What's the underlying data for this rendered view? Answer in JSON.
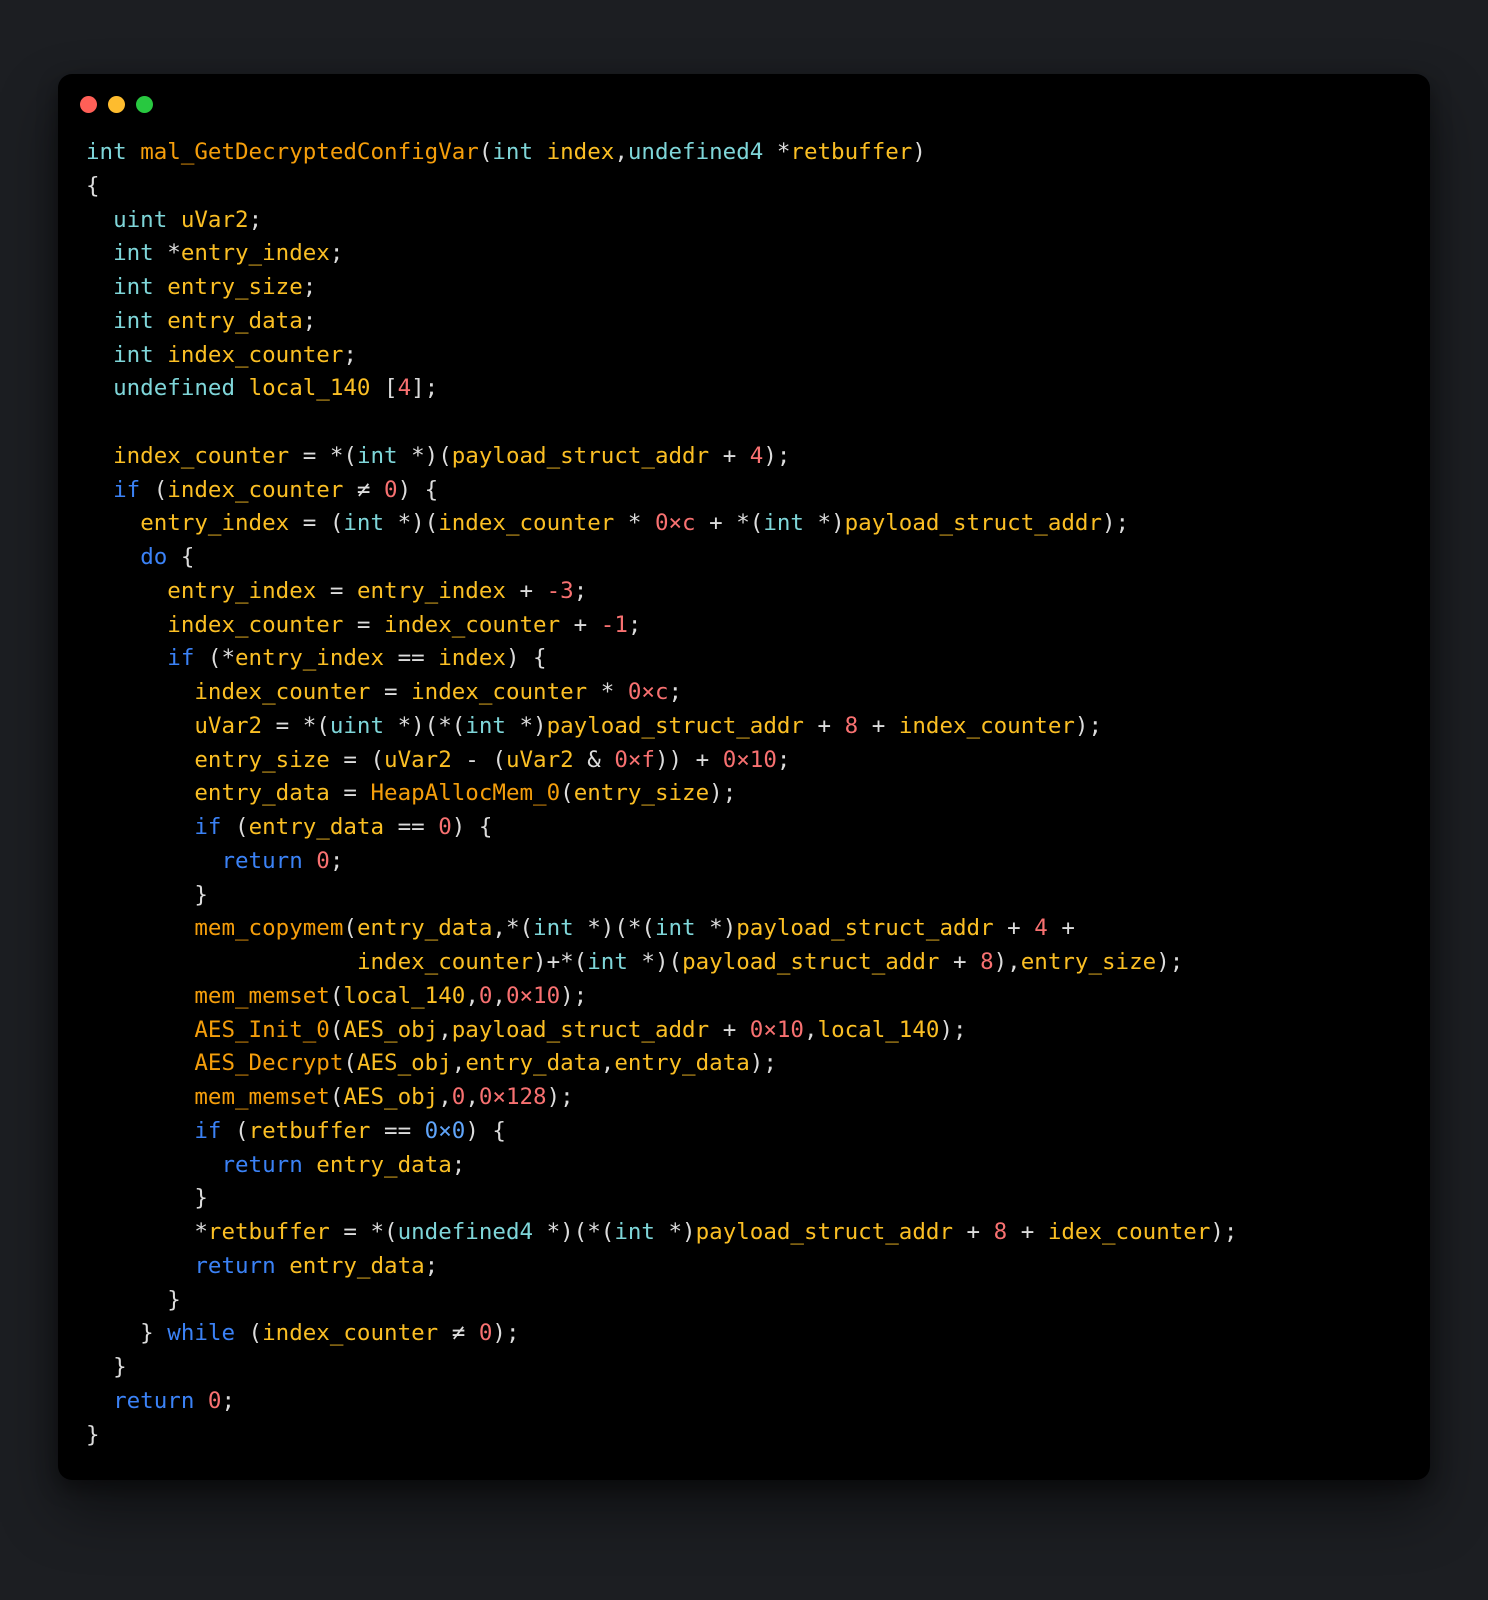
{
  "window": {
    "traffic_icons": [
      "close-icon",
      "minimize-icon",
      "zoom-icon"
    ]
  },
  "colors": {
    "bg_outer": "#1c1e22",
    "bg_code": "#000000",
    "plain": "#dcdcdc",
    "type": "#7fd6d9",
    "keyword": "#3b82f6",
    "function": "#f59e0b",
    "identifier": "#fbbf24",
    "number": "#f87171",
    "constant": "#60a5fa"
  },
  "code": {
    "tokens": [
      [
        [
          "ty",
          "int"
        ],
        [
          "pl",
          " "
        ],
        [
          "fn",
          "mal_GetDecryptedConfigVar"
        ],
        [
          "pl",
          "("
        ],
        [
          "ty",
          "int"
        ],
        [
          "pl",
          " "
        ],
        [
          "id",
          "index"
        ],
        [
          "pl",
          ","
        ],
        [
          "ty",
          "undefined4"
        ],
        [
          "pl",
          " *"
        ],
        [
          "id",
          "retbuffer"
        ],
        [
          "pl",
          ")"
        ]
      ],
      [
        [
          "pl",
          "{"
        ]
      ],
      [
        [
          "pl",
          "  "
        ],
        [
          "ty",
          "uint"
        ],
        [
          "pl",
          " "
        ],
        [
          "id",
          "uVar2"
        ],
        [
          "pl",
          ";"
        ]
      ],
      [
        [
          "pl",
          "  "
        ],
        [
          "ty",
          "int"
        ],
        [
          "pl",
          " *"
        ],
        [
          "id",
          "entry_index"
        ],
        [
          "pl",
          ";"
        ]
      ],
      [
        [
          "pl",
          "  "
        ],
        [
          "ty",
          "int"
        ],
        [
          "pl",
          " "
        ],
        [
          "id",
          "entry_size"
        ],
        [
          "pl",
          ";"
        ]
      ],
      [
        [
          "pl",
          "  "
        ],
        [
          "ty",
          "int"
        ],
        [
          "pl",
          " "
        ],
        [
          "id",
          "entry_data"
        ],
        [
          "pl",
          ";"
        ]
      ],
      [
        [
          "pl",
          "  "
        ],
        [
          "ty",
          "int"
        ],
        [
          "pl",
          " "
        ],
        [
          "id",
          "index_counter"
        ],
        [
          "pl",
          ";"
        ]
      ],
      [
        [
          "pl",
          "  "
        ],
        [
          "ty",
          "undefined"
        ],
        [
          "pl",
          " "
        ],
        [
          "id",
          "local_140"
        ],
        [
          "pl",
          " ["
        ],
        [
          "num",
          "4"
        ],
        [
          "pl",
          "];"
        ]
      ],
      [],
      [
        [
          "pl",
          "  "
        ],
        [
          "id",
          "index_counter"
        ],
        [
          "pl",
          " = *("
        ],
        [
          "ty",
          "int"
        ],
        [
          "pl",
          " *)("
        ],
        [
          "id",
          "payload_struct_addr"
        ],
        [
          "pl",
          " + "
        ],
        [
          "num",
          "4"
        ],
        [
          "pl",
          ");"
        ]
      ],
      [
        [
          "pl",
          "  "
        ],
        [
          "kw",
          "if"
        ],
        [
          "pl",
          " ("
        ],
        [
          "id",
          "index_counter"
        ],
        [
          "pl",
          " ≠ "
        ],
        [
          "num",
          "0"
        ],
        [
          "pl",
          ") {"
        ]
      ],
      [
        [
          "pl",
          "    "
        ],
        [
          "id",
          "entry_index"
        ],
        [
          "pl",
          " = ("
        ],
        [
          "ty",
          "int"
        ],
        [
          "pl",
          " *)("
        ],
        [
          "id",
          "index_counter"
        ],
        [
          "pl",
          " * "
        ],
        [
          "num",
          "0×c"
        ],
        [
          "pl",
          " + *("
        ],
        [
          "ty",
          "int"
        ],
        [
          "pl",
          " *)"
        ],
        [
          "id",
          "payload_struct_addr"
        ],
        [
          "pl",
          ");"
        ]
      ],
      [
        [
          "pl",
          "    "
        ],
        [
          "kw",
          "do"
        ],
        [
          "pl",
          " {"
        ]
      ],
      [
        [
          "pl",
          "      "
        ],
        [
          "id",
          "entry_index"
        ],
        [
          "pl",
          " = "
        ],
        [
          "id",
          "entry_index"
        ],
        [
          "pl",
          " + "
        ],
        [
          "num",
          "-3"
        ],
        [
          "pl",
          ";"
        ]
      ],
      [
        [
          "pl",
          "      "
        ],
        [
          "id",
          "index_counter"
        ],
        [
          "pl",
          " = "
        ],
        [
          "id",
          "index_counter"
        ],
        [
          "pl",
          " + "
        ],
        [
          "num",
          "-1"
        ],
        [
          "pl",
          ";"
        ]
      ],
      [
        [
          "pl",
          "      "
        ],
        [
          "kw",
          "if"
        ],
        [
          "pl",
          " (*"
        ],
        [
          "id",
          "entry_index"
        ],
        [
          "pl",
          " == "
        ],
        [
          "id",
          "index"
        ],
        [
          "pl",
          ") {"
        ]
      ],
      [
        [
          "pl",
          "        "
        ],
        [
          "id",
          "index_counter"
        ],
        [
          "pl",
          " = "
        ],
        [
          "id",
          "index_counter"
        ],
        [
          "pl",
          " * "
        ],
        [
          "num",
          "0×c"
        ],
        [
          "pl",
          ";"
        ]
      ],
      [
        [
          "pl",
          "        "
        ],
        [
          "id",
          "uVar2"
        ],
        [
          "pl",
          " = *("
        ],
        [
          "ty",
          "uint"
        ],
        [
          "pl",
          " *)(*("
        ],
        [
          "ty",
          "int"
        ],
        [
          "pl",
          " *)"
        ],
        [
          "id",
          "payload_struct_addr"
        ],
        [
          "pl",
          " + "
        ],
        [
          "num",
          "8"
        ],
        [
          "pl",
          " + "
        ],
        [
          "id",
          "index_counter"
        ],
        [
          "pl",
          ");"
        ]
      ],
      [
        [
          "pl",
          "        "
        ],
        [
          "id",
          "entry_size"
        ],
        [
          "pl",
          " = ("
        ],
        [
          "id",
          "uVar2"
        ],
        [
          "pl",
          " - ("
        ],
        [
          "id",
          "uVar2"
        ],
        [
          "pl",
          " & "
        ],
        [
          "num",
          "0×f"
        ],
        [
          "pl",
          ")) + "
        ],
        [
          "num",
          "0×10"
        ],
        [
          "pl",
          ";"
        ]
      ],
      [
        [
          "pl",
          "        "
        ],
        [
          "id",
          "entry_data"
        ],
        [
          "pl",
          " = "
        ],
        [
          "fn",
          "HeapAllocMem_0"
        ],
        [
          "pl",
          "("
        ],
        [
          "id",
          "entry_size"
        ],
        [
          "pl",
          ");"
        ]
      ],
      [
        [
          "pl",
          "        "
        ],
        [
          "kw",
          "if"
        ],
        [
          "pl",
          " ("
        ],
        [
          "id",
          "entry_data"
        ],
        [
          "pl",
          " == "
        ],
        [
          "num",
          "0"
        ],
        [
          "pl",
          ") {"
        ]
      ],
      [
        [
          "pl",
          "          "
        ],
        [
          "kw",
          "return"
        ],
        [
          "pl",
          " "
        ],
        [
          "num",
          "0"
        ],
        [
          "pl",
          ";"
        ]
      ],
      [
        [
          "pl",
          "        }"
        ]
      ],
      [
        [
          "pl",
          "        "
        ],
        [
          "fn",
          "mem_copymem"
        ],
        [
          "pl",
          "("
        ],
        [
          "id",
          "entry_data"
        ],
        [
          "pl",
          ",*("
        ],
        [
          "ty",
          "int"
        ],
        [
          "pl",
          " *)(*("
        ],
        [
          "ty",
          "int"
        ],
        [
          "pl",
          " *)"
        ],
        [
          "id",
          "payload_struct_addr"
        ],
        [
          "pl",
          " + "
        ],
        [
          "num",
          "4"
        ],
        [
          "pl",
          " +"
        ]
      ],
      [
        [
          "pl",
          "                    "
        ],
        [
          "id",
          "index_counter"
        ],
        [
          "pl",
          ")+*("
        ],
        [
          "ty",
          "int"
        ],
        [
          "pl",
          " *)("
        ],
        [
          "id",
          "payload_struct_addr"
        ],
        [
          "pl",
          " + "
        ],
        [
          "num",
          "8"
        ],
        [
          "pl",
          "),"
        ],
        [
          "id",
          "entry_size"
        ],
        [
          "pl",
          ");"
        ]
      ],
      [
        [
          "pl",
          "        "
        ],
        [
          "fn",
          "mem_memset"
        ],
        [
          "pl",
          "("
        ],
        [
          "id",
          "local_140"
        ],
        [
          "pl",
          ","
        ],
        [
          "num",
          "0"
        ],
        [
          "pl",
          ","
        ],
        [
          "num",
          "0×10"
        ],
        [
          "pl",
          ");"
        ]
      ],
      [
        [
          "pl",
          "        "
        ],
        [
          "fn",
          "AES_Init_0"
        ],
        [
          "pl",
          "("
        ],
        [
          "id",
          "AES_obj"
        ],
        [
          "pl",
          ","
        ],
        [
          "id",
          "payload_struct_addr"
        ],
        [
          "pl",
          " + "
        ],
        [
          "num",
          "0×10"
        ],
        [
          "pl",
          ","
        ],
        [
          "id",
          "local_140"
        ],
        [
          "pl",
          ");"
        ]
      ],
      [
        [
          "pl",
          "        "
        ],
        [
          "fn",
          "AES_Decrypt"
        ],
        [
          "pl",
          "("
        ],
        [
          "id",
          "AES_obj"
        ],
        [
          "pl",
          ","
        ],
        [
          "id",
          "entry_data"
        ],
        [
          "pl",
          ","
        ],
        [
          "id",
          "entry_data"
        ],
        [
          "pl",
          ");"
        ]
      ],
      [
        [
          "pl",
          "        "
        ],
        [
          "fn",
          "mem_memset"
        ],
        [
          "pl",
          "("
        ],
        [
          "id",
          "AES_obj"
        ],
        [
          "pl",
          ","
        ],
        [
          "num",
          "0"
        ],
        [
          "pl",
          ","
        ],
        [
          "num",
          "0×128"
        ],
        [
          "pl",
          ");"
        ]
      ],
      [
        [
          "pl",
          "        "
        ],
        [
          "kw",
          "if"
        ],
        [
          "pl",
          " ("
        ],
        [
          "id",
          "retbuffer"
        ],
        [
          "pl",
          " == "
        ],
        [
          "cst",
          "0×0"
        ],
        [
          "pl",
          ") {"
        ]
      ],
      [
        [
          "pl",
          "          "
        ],
        [
          "kw",
          "return"
        ],
        [
          "pl",
          " "
        ],
        [
          "id",
          "entry_data"
        ],
        [
          "pl",
          ";"
        ]
      ],
      [
        [
          "pl",
          "        }"
        ]
      ],
      [
        [
          "pl",
          "        *"
        ],
        [
          "id",
          "retbuffer"
        ],
        [
          "pl",
          " = *("
        ],
        [
          "ty",
          "undefined4"
        ],
        [
          "pl",
          " *)(*("
        ],
        [
          "ty",
          "int"
        ],
        [
          "pl",
          " *)"
        ],
        [
          "id",
          "payload_struct_addr"
        ],
        [
          "pl",
          " + "
        ],
        [
          "num",
          "8"
        ],
        [
          "pl",
          " + "
        ],
        [
          "id",
          "idex_counter"
        ],
        [
          "pl",
          ");"
        ]
      ],
      [
        [
          "pl",
          "        "
        ],
        [
          "kw",
          "return"
        ],
        [
          "pl",
          " "
        ],
        [
          "id",
          "entry_data"
        ],
        [
          "pl",
          ";"
        ]
      ],
      [
        [
          "pl",
          "      }"
        ]
      ],
      [
        [
          "pl",
          "    } "
        ],
        [
          "kw",
          "while"
        ],
        [
          "pl",
          " ("
        ],
        [
          "id",
          "index_counter"
        ],
        [
          "pl",
          " ≠ "
        ],
        [
          "num",
          "0"
        ],
        [
          "pl",
          ");"
        ]
      ],
      [
        [
          "pl",
          "  }"
        ]
      ],
      [
        [
          "pl",
          "  "
        ],
        [
          "kw",
          "return"
        ],
        [
          "pl",
          " "
        ],
        [
          "num",
          "0"
        ],
        [
          "pl",
          ";"
        ]
      ],
      [
        [
          "pl",
          "}"
        ]
      ]
    ]
  }
}
